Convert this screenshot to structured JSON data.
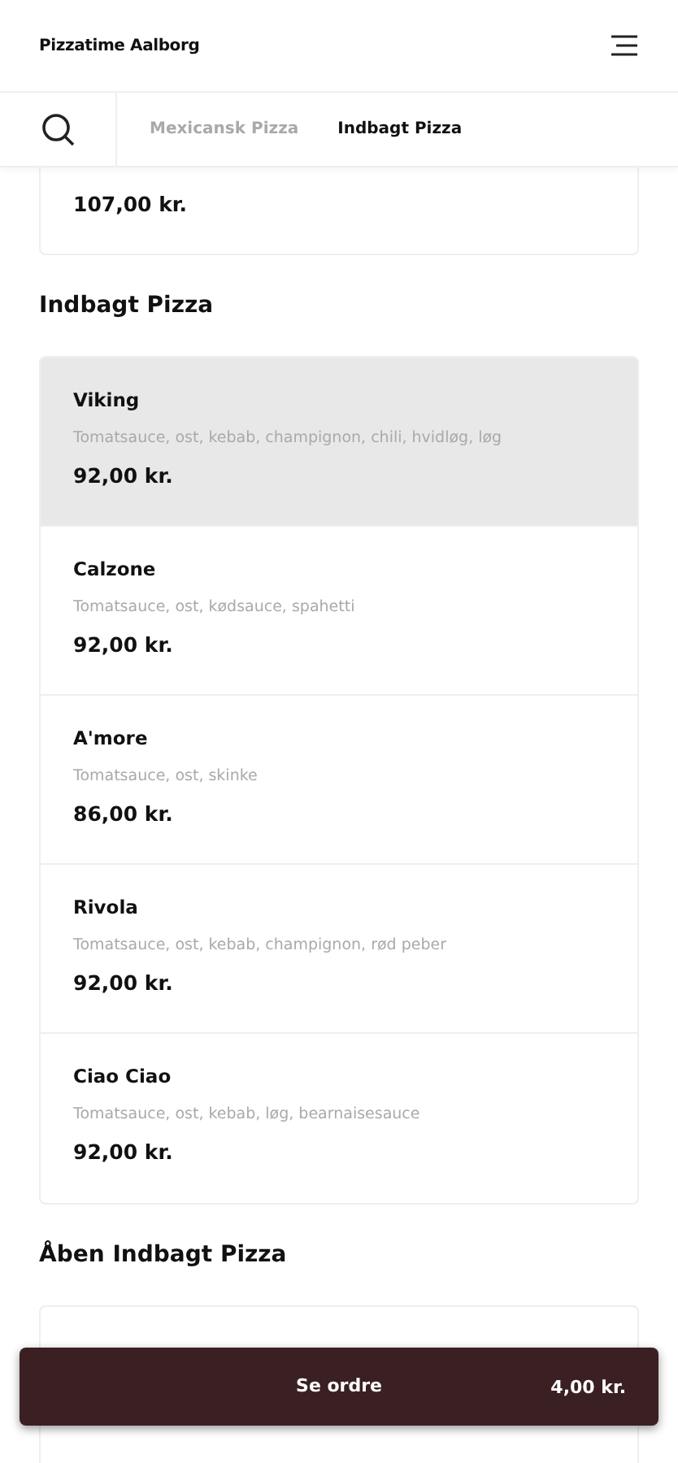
{
  "header": {
    "title": "Pizzatime Aalborg"
  },
  "tabs": [
    {
      "label": "Mexicansk Pizza",
      "selected": false
    },
    {
      "label": "Indbagt Pizza",
      "selected": true
    }
  ],
  "previous_item": {
    "price": "107,00 kr."
  },
  "sections": [
    {
      "title": "Indbagt Pizza",
      "items": [
        {
          "name": "Viking",
          "description": "Tomatsauce, ost, kebab, champignon, chili, hvidløg, løg",
          "price": "92,00 kr.",
          "selected": true
        },
        {
          "name": "Calzone",
          "description": "Tomatsauce, ost, kødsauce, spahetti",
          "price": "92,00 kr.",
          "selected": false
        },
        {
          "name": "A'more",
          "description": "Tomatsauce, ost, skinke",
          "price": "86,00 kr.",
          "selected": false
        },
        {
          "name": "Rivola",
          "description": "Tomatsauce, ost, kebab, champignon, rød peber",
          "price": "92,00 kr.",
          "selected": false
        },
        {
          "name": "Ciao Ciao",
          "description": "Tomatsauce, ost, kebab, løg, bearnaisesauce",
          "price": "92,00 kr.",
          "selected": false
        }
      ]
    },
    {
      "title": "Åben Indbagt Pizza"
    }
  ],
  "order_button": {
    "label": "Se ordre",
    "total": "4,00 kr."
  }
}
